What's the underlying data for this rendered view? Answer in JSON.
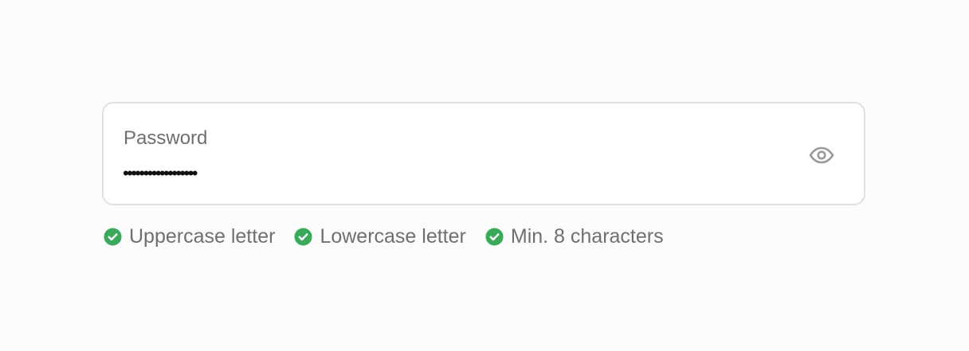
{
  "password_field": {
    "label": "Password",
    "value_masked": "••••••••••••••••••",
    "toggle_icon": "eye-icon"
  },
  "requirements": [
    {
      "label": "Uppercase letter",
      "icon": "check-circle-icon",
      "met": true
    },
    {
      "label": "Lowercase letter",
      "icon": "check-circle-icon",
      "met": true
    },
    {
      "label": "Min. 8 characters",
      "icon": "check-circle-icon",
      "met": true
    }
  ],
  "colors": {
    "success": "#3aa95a",
    "label_text": "#6f6f6f",
    "border": "#e0e0e0",
    "icon_gray": "#9a9a9a"
  }
}
